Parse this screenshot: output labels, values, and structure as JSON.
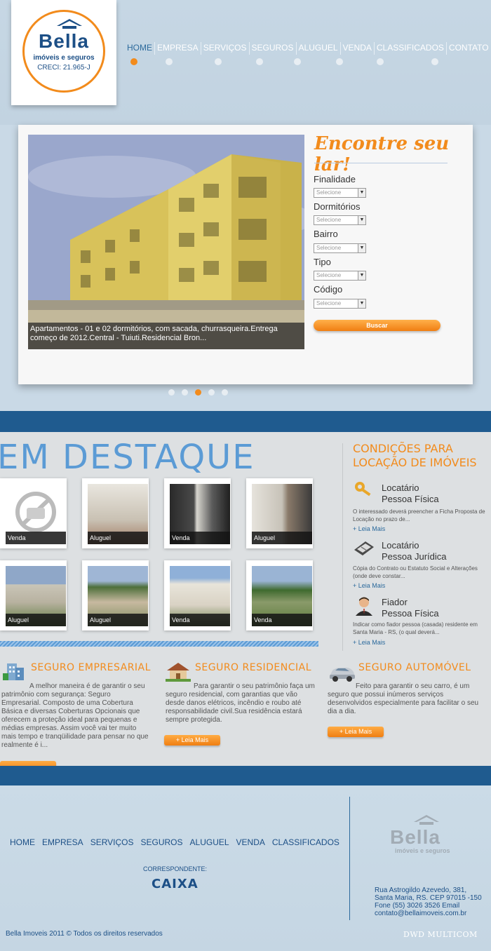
{
  "brand": {
    "name": "Bella",
    "tagline": "imóveis e seguros",
    "creci": "CRECI: 21.965-J",
    "accent": "#f28b1c",
    "primary": "#1c4f86"
  },
  "nav": {
    "items": [
      "HOME",
      "EMPRESA",
      "SERVIÇOS",
      "SEGUROS",
      "ALUGUEL",
      "VENDA",
      "CLASSIFICADOS",
      "CONTATO"
    ],
    "active": "HOME"
  },
  "slider": {
    "caption": "Apartamentos - 01 e 02 dormitórios, com sacada, churrasqueira.Entrega começo de 2012.Central - Tuiuti.Residencial Bron...",
    "active_slide": 3,
    "slide_count": 5
  },
  "search": {
    "title": "Encontre seu lar!",
    "fields": [
      {
        "label": "Finalidade",
        "value": "Selecione"
      },
      {
        "label": "Dormitórios",
        "value": "Selecione"
      },
      {
        "label": "Bairro",
        "value": "Selecione"
      },
      {
        "label": "Tipo",
        "value": "Selecione"
      },
      {
        "label": "Código",
        "value": "Selecione"
      }
    ],
    "button": "Buscar"
  },
  "destaque": {
    "title": "EM DESTAQUE",
    "items": [
      {
        "tag": "Venda",
        "icon": "no-photo-icon"
      },
      {
        "tag": "Aluguel",
        "icon": "interior-photo"
      },
      {
        "tag": "Venda",
        "icon": "interior-photo"
      },
      {
        "tag": "Aluguel",
        "icon": "interior-photo"
      },
      {
        "tag": "Aluguel",
        "icon": "house-photo"
      },
      {
        "tag": "Aluguel",
        "icon": "house-photo"
      },
      {
        "tag": "Venda",
        "icon": "house-photo"
      },
      {
        "tag": "Venda",
        "icon": "house-photo"
      }
    ]
  },
  "conditions": {
    "title_line1": "CONDIÇÕES PARA",
    "title_line2": "LOCAÇÃO DE IMÓVEIS",
    "items": [
      {
        "line1": "Locatário",
        "line2": "Pessoa Física",
        "icon": "key-icon",
        "desc": "O interessado deverá preencher a Ficha Proposta de Locação no prazo de...",
        "more": "+ Leia Mais"
      },
      {
        "line1": "Locatário",
        "line2": "Pessoa Jurídica",
        "icon": "document-icon",
        "desc": "Cópia do Contrato ou Estatuto Social e Alterações (onde deve constar...",
        "more": "+ Leia Mais"
      },
      {
        "line1": "Fiador",
        "line2": "Pessoa Física",
        "icon": "person-icon",
        "desc": "Indicar como fiador pessoa (casada) residente em Santa Maria - RS, (o qual deverá...",
        "more": "+ Leia Mais"
      }
    ]
  },
  "insurance": [
    {
      "title": "SEGURO EMPRESARIAL",
      "icon": "building-icon",
      "text": "A melhor maneira é de garantir o seu patrimônio com segurança: Seguro Empresarial. Composto de uma Cobertura Básica e diversas Coberturas Opcionais que oferecem a proteção ideal para pequenas e médias empresas. Assim você vai ter muito mais tempo e tranqüilidade para pensar no que realmente é i...",
      "more": "+ Leia Mais"
    },
    {
      "title": "SEGURO RESIDENCIAL",
      "icon": "house-icon",
      "text": "Para garantir o seu patrimônio faça um seguro residencial, com garantias que vão desde danos elétricos, incêndio e roubo até responsabilidade civil.Sua residência estará sempre protegida.",
      "more": "+ Leia Mais"
    },
    {
      "title": "SEGURO AUTOMÓVEL",
      "icon": "car-icon",
      "text": "Feito para garantir o seu carro, é um seguro que possui inúmeros serviços desenvolvidos especialmente para facilitar o seu dia a dia.",
      "more": "+ Leia Mais"
    }
  ],
  "footer": {
    "links": [
      "HOME",
      "EMPRESA",
      "SERVIÇOS",
      "SEGUROS",
      "ALUGUEL",
      "VENDA",
      "CLASSIFICADOS"
    ],
    "correspondent_label": "CORRESPONDENTE:",
    "correspondent": "CAIXA",
    "address": [
      "Rua Astrogildo Azevedo, 381,",
      "Santa Maria, RS. CEP 97015 -150",
      "Fone (55) 3026 3526 Email",
      "contato@bellaimoveis.com.br"
    ],
    "copyright": "Bella Imoveis 2011 © Todos os direitos reservados",
    "developer": "DWD MULTICOM"
  }
}
